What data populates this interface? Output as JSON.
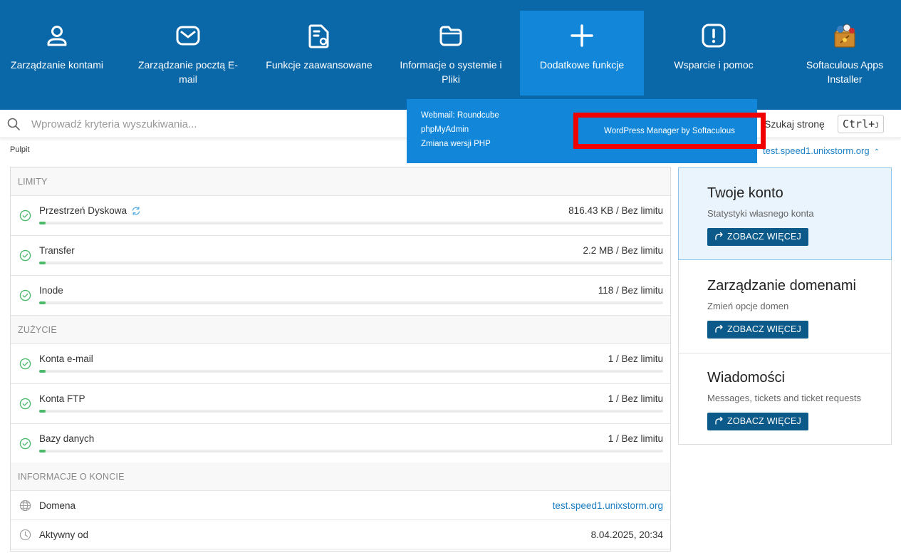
{
  "nav": {
    "items": [
      {
        "label": "Zarządzanie kontami",
        "icon": "user-icon"
      },
      {
        "label": "Zarządzanie pocztą E-mail",
        "icon": "mail-icon"
      },
      {
        "label": "Funkcje zaawansowane",
        "icon": "file-gear-icon"
      },
      {
        "label": "Informacje o systemie i Pliki",
        "icon": "folder-icon"
      },
      {
        "label": "Dodatkowe funkcje",
        "icon": "plus-icon",
        "active": true
      },
      {
        "label": "Wsparcie i pomoc",
        "icon": "alert-icon"
      },
      {
        "label": "Softaculous Apps Installer",
        "icon": "softaculous-logo-icon"
      }
    ]
  },
  "dropdown": {
    "links": [
      "Webmail: Roundcube",
      "phpMyAdmin",
      "Zmiana wersji PHP"
    ],
    "highlighted": "WordPress Manager by Softaculous"
  },
  "search": {
    "placeholder": "Wprowadź kryteria wyszukiwania...",
    "search_page_label": "Szukaj stronę",
    "shortcut_main": "Ctrl+",
    "shortcut_key": "J"
  },
  "breadcrumb": "Pulpit",
  "domain_selector": "test.speed1.unixstorm.org",
  "limits": {
    "title": "LIMITY",
    "rows": [
      {
        "name": "Przestrzeń Dyskowa",
        "value": "816.43 KB / Bez limitu",
        "usage": 0.01
      },
      {
        "name": "Transfer",
        "value": "2.2 MB / Bez limitu",
        "usage": 0.01
      },
      {
        "name": "Inode",
        "value": "118 / Bez limitu",
        "usage": 0.01
      }
    ]
  },
  "usage": {
    "title": "ZUŻYCIE",
    "rows": [
      {
        "name": "Konta e-mail",
        "value": "1 / Bez limitu",
        "usage": 0.01
      },
      {
        "name": "Konta FTP",
        "value": "1 / Bez limitu",
        "usage": 0.01
      },
      {
        "name": "Bazy danych",
        "value": "1 / Bez limitu",
        "usage": 0.01
      }
    ]
  },
  "account_info": {
    "title": "INFORMACJE O KONCIE",
    "rows": [
      {
        "name": "Domena",
        "value": "test.speed1.unixstorm.org",
        "icon": "globe-icon"
      },
      {
        "name": "Aktywny od",
        "value": "8.04.2025, 20:34",
        "icon": "clock-icon"
      }
    ]
  },
  "cards": [
    {
      "title": "Twoje konto",
      "desc": "Statystyki własnego konta",
      "button": "ZOBACZ WIĘCEJ"
    },
    {
      "title": "Zarządzanie domenami",
      "desc": "Zmień opcje domen",
      "button": "ZOBACZ WIĘCEJ"
    },
    {
      "title": "Wiadomości",
      "desc": "Messages, tickets and ticket requests",
      "button": "ZOBACZ WIĘCEJ"
    }
  ],
  "colors": {
    "nav_bg": "#0a67a8",
    "nav_active": "#1287d9",
    "accent_link": "#1a7ec4",
    "progress_fill": "#4cba6a",
    "button_bg": "#0b5a8a",
    "highlight_border": "#f00000"
  }
}
